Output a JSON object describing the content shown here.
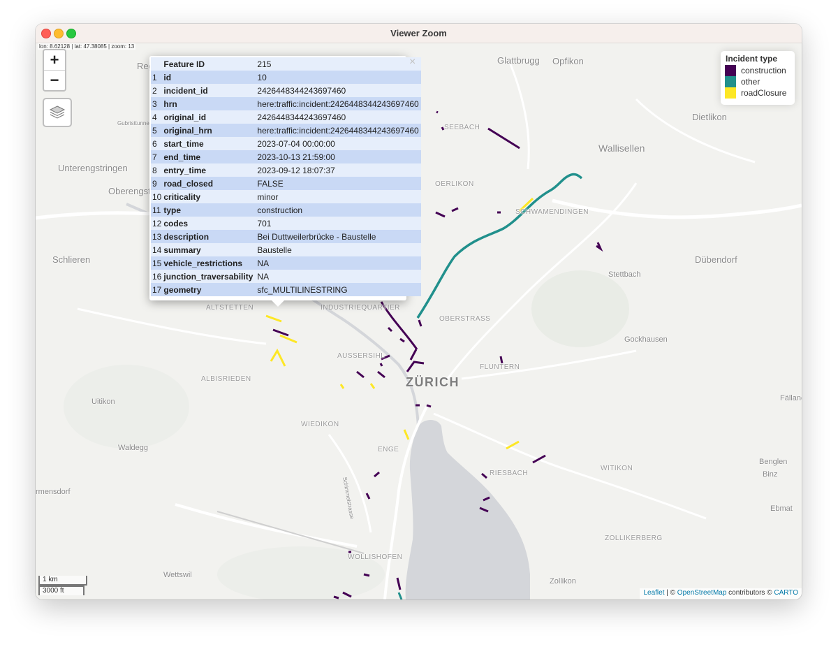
{
  "window": {
    "title": "Viewer Zoom"
  },
  "map": {
    "coords_readout": "lon: 8.62128 | lat: 47.38085 | zoom: 13",
    "zoom_in": "+",
    "zoom_out": "−",
    "places": {
      "glattbrugg": "Glattbrugg",
      "opfikon": "Opfikon",
      "dietlikon": "Dietlikon",
      "seebach": "SEEBACH",
      "wallisellen": "Wallisellen",
      "unterengstringen": "Unterengstringen",
      "oberengstringen": "Oberengstringen",
      "oerlikon": "OERLIKON",
      "schwamendingen": "SCHWAMENDINGEN",
      "schlieren": "Schlieren",
      "duebendorf": "Dübendorf",
      "stettbach": "Stettbach",
      "altstetten": "ALTSTETTEN",
      "industriequartier": "INDUSTRIEQUARTIER",
      "oberstrass": "OBERSTRASS",
      "gockhausen": "Gockhausen",
      "aussersihl": "AUSSERSIHL",
      "fluntern": "FLUNTERN",
      "albisrieden": "ALBISRIEDEN",
      "zurich": "ZÜRICH",
      "uitikon": "Uitikon",
      "faellanden": "Fällanc",
      "wiedikon": "WIEDIKON",
      "waldegg": "Waldegg",
      "enge": "ENGE",
      "witikon": "WITIKON",
      "benglen": "Benglen",
      "riesbach": "RIESBACH",
      "binz": "Binz",
      "birmensdorf": "rmensdorf",
      "ebmat": "Ebmat",
      "zollikerberg": "ZOLLIKERBERG",
      "wollishofen": "WOLLISHOFEN",
      "wettswil": "Wettswil",
      "zollikon": "Zollikon",
      "regensdorf": "Reg",
      "gubristtunnel": "Gubristtunnel",
      "schimmelstrasse": "Schimmelstrasse"
    }
  },
  "legend": {
    "title": "Incident type",
    "items": [
      {
        "label": "construction",
        "color": "#440154"
      },
      {
        "label": "other",
        "color": "#21908c"
      },
      {
        "label": "roadClosure",
        "color": "#fde725"
      }
    ]
  },
  "popup": {
    "close": "×",
    "header": {
      "key": "Feature ID",
      "value": "215"
    },
    "rows": [
      {
        "idx": "1",
        "key": "id",
        "value": "10"
      },
      {
        "idx": "2",
        "key": "incident_id",
        "value": "2426448344243697460"
      },
      {
        "idx": "3",
        "key": "hrn",
        "value": "here:traffic:incident:2426448344243697460"
      },
      {
        "idx": "4",
        "key": "original_id",
        "value": "2426448344243697460"
      },
      {
        "idx": "5",
        "key": "original_hrn",
        "value": "here:traffic:incident:2426448344243697460"
      },
      {
        "idx": "6",
        "key": "start_time",
        "value": "2023-07-04 00:00:00"
      },
      {
        "idx": "7",
        "key": "end_time",
        "value": "2023-10-13 21:59:00"
      },
      {
        "idx": "8",
        "key": "entry_time",
        "value": "2023-09-12 18:07:37"
      },
      {
        "idx": "9",
        "key": "road_closed",
        "value": "FALSE"
      },
      {
        "idx": "10",
        "key": "criticality",
        "value": "minor"
      },
      {
        "idx": "11",
        "key": "type",
        "value": "construction"
      },
      {
        "idx": "12",
        "key": "codes",
        "value": "701"
      },
      {
        "idx": "13",
        "key": "description",
        "value": "Bei Duttweilerbrücke - Baustelle"
      },
      {
        "idx": "14",
        "key": "summary",
        "value": "Baustelle"
      },
      {
        "idx": "15",
        "key": "vehicle_restrictions",
        "value": "NA"
      },
      {
        "idx": "16",
        "key": "junction_traversability",
        "value": "NA"
      },
      {
        "idx": "17",
        "key": "geometry",
        "value": "sfc_MULTILINESTRING"
      }
    ]
  },
  "scale": {
    "metric": "1 km",
    "imperial": "3000 ft"
  },
  "attribution": {
    "leaflet": "Leaflet",
    "sep": " | © ",
    "osm": "OpenStreetMap",
    "contrib": " contributors © ",
    "carto": "CARTO"
  }
}
